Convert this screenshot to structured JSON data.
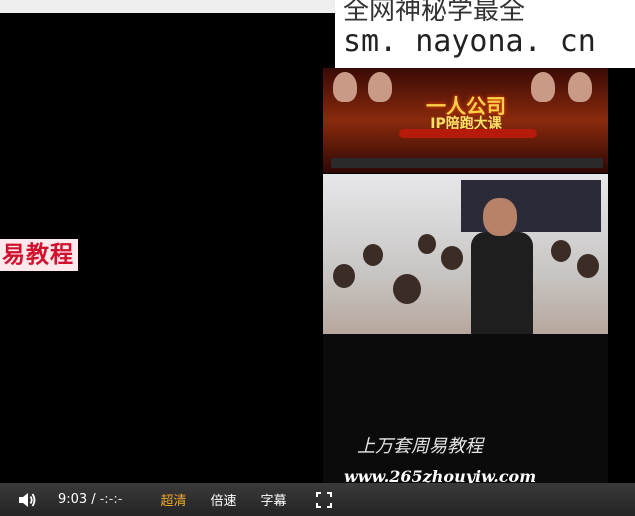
{
  "left_watermark": "易教程",
  "corner_overlay": {
    "line1": "全网神秘学最全",
    "line2": "sm. nayona. cn"
  },
  "banner": {
    "title": "一人公司",
    "subtitle": "IP陪跑大课"
  },
  "video_watermark": {
    "line1": "上万套周易教程",
    "line2": "www.265zhouyiw.com"
  },
  "player": {
    "current_time": "9:03",
    "separator": "/",
    "duration": "-:-:-",
    "quality_label": "超清",
    "speed_label": "倍速",
    "subtitle_label": "字幕"
  },
  "colors": {
    "active_control": "#f1a62b",
    "watermark_red": "#d0122f"
  }
}
